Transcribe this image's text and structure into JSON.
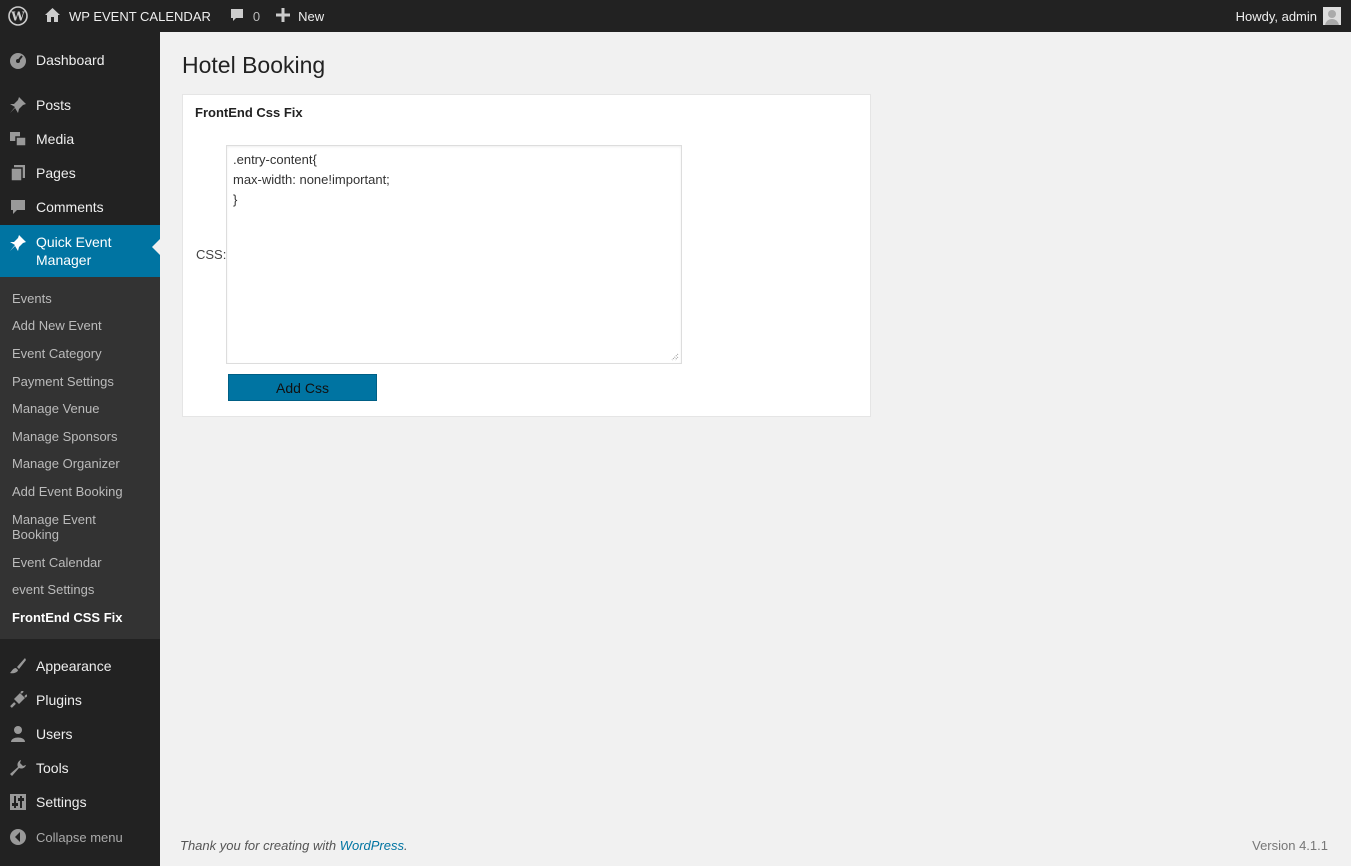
{
  "admin_bar": {
    "site_name": "WP EVENT CALENDAR",
    "comments_count": "0",
    "new_label": "New",
    "howdy": "Howdy, admin"
  },
  "sidebar": {
    "top_items": [
      {
        "label": "Dashboard",
        "icon": "dashboard-icon"
      },
      {
        "label": "Posts",
        "icon": "pushpin-icon"
      },
      {
        "label": "Media",
        "icon": "media-icon"
      },
      {
        "label": "Pages",
        "icon": "pages-icon"
      },
      {
        "label": "Comments",
        "icon": "comment-icon"
      }
    ],
    "current_item": {
      "label": "Quick Event Manager",
      "icon": "pushpin-icon"
    },
    "submenu": [
      "Events",
      "Add New Event",
      "Event Category",
      "Payment Settings",
      "Manage Venue",
      "Manage Sponsors",
      "Manage Organizer",
      "Add Event Booking",
      "Manage Event Booking",
      "Event Calendar",
      "event Settings",
      "FrontEnd CSS Fix"
    ],
    "current_submenu": "FrontEnd CSS Fix",
    "bottom_items": [
      {
        "label": "Appearance",
        "icon": "brush-icon"
      },
      {
        "label": "Plugins",
        "icon": "plugin-icon"
      },
      {
        "label": "Users",
        "icon": "user-icon"
      },
      {
        "label": "Tools",
        "icon": "wrench-icon"
      },
      {
        "label": "Settings",
        "icon": "settings-icon"
      }
    ],
    "collapse_label": "Collapse menu"
  },
  "main": {
    "page_title": "Hotel Booking",
    "box_title": "FrontEnd Css Fix",
    "css_label": "CSS:",
    "css_value": ".entry-content{\nmax-width: none!important;\n}",
    "button_label": "Add Css"
  },
  "footer": {
    "thanks_text": "Thank you for creating with ",
    "thanks_link": "WordPress",
    "thanks_end": ".",
    "version": "Version 4.1.1"
  },
  "colors": {
    "admin_bar": "#222222",
    "sidebar": "#222222",
    "submenu": "#333333",
    "accent": "#0074a2",
    "background": "#f1f1f1"
  }
}
